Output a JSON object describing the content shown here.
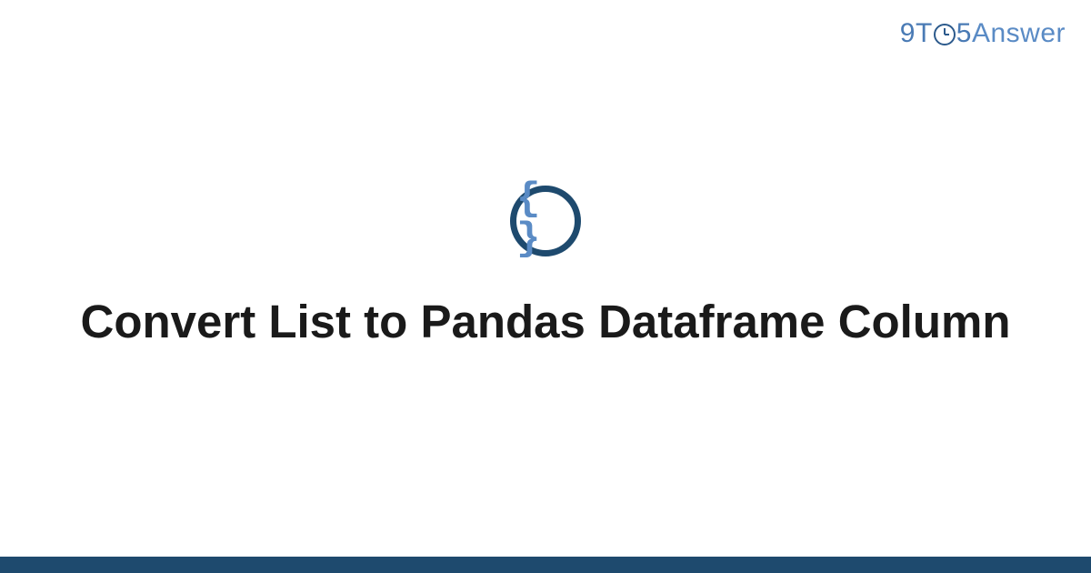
{
  "brand": {
    "prefix_nine": "9",
    "prefix_t": "T",
    "suffix_five": "5",
    "suffix_word": "Answer"
  },
  "icon": {
    "braces": "{ }"
  },
  "title": "Convert List to Pandas Dataframe Column",
  "colors": {
    "brand_dark": "#1e4a6e",
    "brand_mid": "#4a7bb5",
    "brand_light": "#5a8bc5"
  }
}
